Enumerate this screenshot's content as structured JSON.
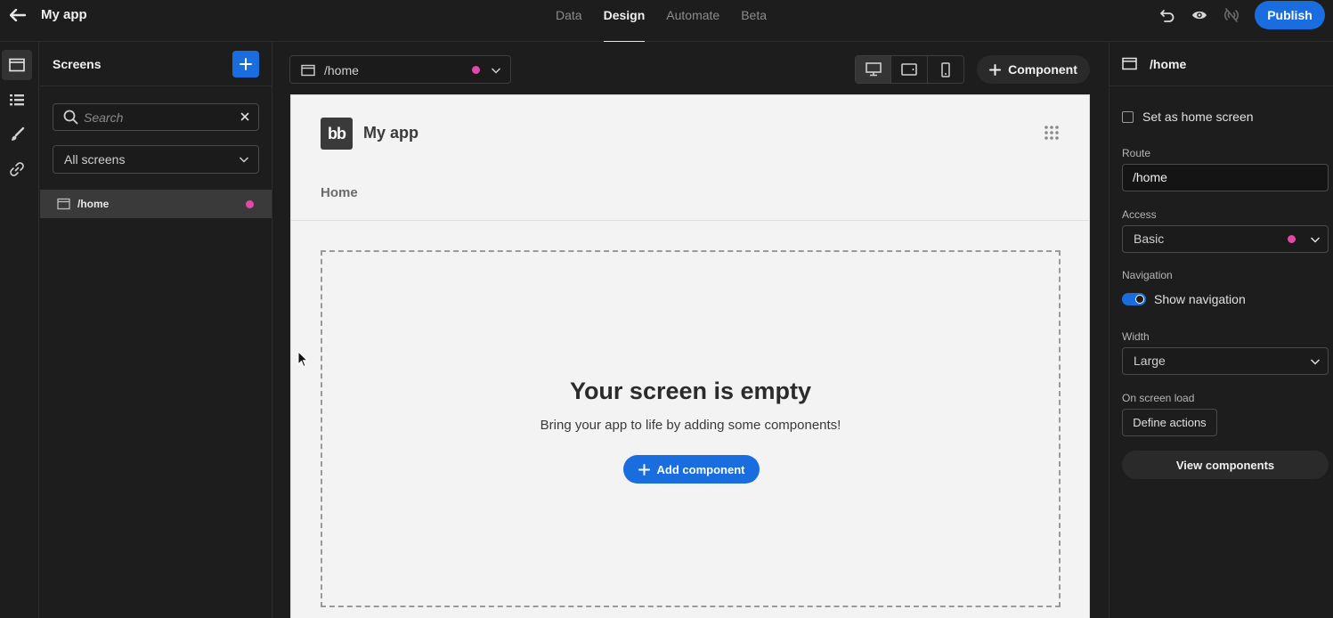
{
  "app": {
    "title": "My app"
  },
  "nav": {
    "tabs": [
      {
        "label": "Data"
      },
      {
        "label": "Design"
      },
      {
        "label": "Automate"
      },
      {
        "label": "Beta"
      }
    ],
    "active": "Design",
    "publish_label": "Publish"
  },
  "screens_panel": {
    "title": "Screens",
    "search_placeholder": "Search",
    "filter_value": "All screens",
    "items": [
      {
        "route": "/home"
      }
    ]
  },
  "canvas": {
    "route_select": "/home",
    "component_button": "Component",
    "preview": {
      "app_title": "My app",
      "logo_text": "bb",
      "nav_items": [
        "Home"
      ],
      "empty_title": "Your screen is empty",
      "empty_subtitle": "Bring your app to life by adding some components!",
      "add_component_label": "Add component"
    }
  },
  "settings": {
    "title": "/home",
    "home_screen_label": "Set as home screen",
    "route_label": "Route",
    "route_value": "/home",
    "access_label": "Access",
    "access_value": "Basic",
    "navigation_label": "Navigation",
    "show_navigation_label": "Show navigation",
    "width_label": "Width",
    "width_value": "Large",
    "on_load_label": "On screen load",
    "define_actions_label": "Define actions",
    "view_components_label": "View components"
  },
  "colors": {
    "accent": "#1a6dde",
    "role_dot": "#e04aa6",
    "background": "#1d1d1d"
  }
}
